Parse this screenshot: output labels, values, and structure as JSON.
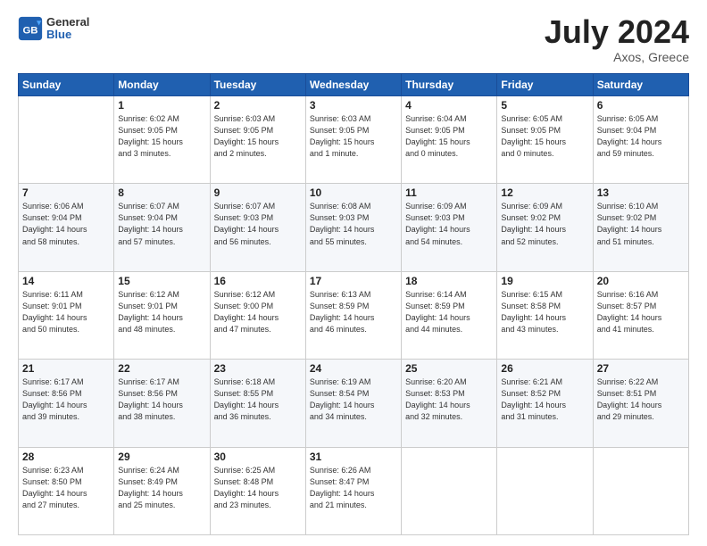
{
  "header": {
    "logo_line1": "General",
    "logo_line2": "Blue",
    "title": "July 2024",
    "location": "Axos, Greece"
  },
  "weekdays": [
    "Sunday",
    "Monday",
    "Tuesday",
    "Wednesday",
    "Thursday",
    "Friday",
    "Saturday"
  ],
  "weeks": [
    [
      {
        "day": "",
        "info": ""
      },
      {
        "day": "1",
        "info": "Sunrise: 6:02 AM\nSunset: 9:05 PM\nDaylight: 15 hours\nand 3 minutes."
      },
      {
        "day": "2",
        "info": "Sunrise: 6:03 AM\nSunset: 9:05 PM\nDaylight: 15 hours\nand 2 minutes."
      },
      {
        "day": "3",
        "info": "Sunrise: 6:03 AM\nSunset: 9:05 PM\nDaylight: 15 hours\nand 1 minute."
      },
      {
        "day": "4",
        "info": "Sunrise: 6:04 AM\nSunset: 9:05 PM\nDaylight: 15 hours\nand 0 minutes."
      },
      {
        "day": "5",
        "info": "Sunrise: 6:05 AM\nSunset: 9:05 PM\nDaylight: 15 hours\nand 0 minutes."
      },
      {
        "day": "6",
        "info": "Sunrise: 6:05 AM\nSunset: 9:04 PM\nDaylight: 14 hours\nand 59 minutes."
      }
    ],
    [
      {
        "day": "7",
        "info": "Sunrise: 6:06 AM\nSunset: 9:04 PM\nDaylight: 14 hours\nand 58 minutes."
      },
      {
        "day": "8",
        "info": "Sunrise: 6:07 AM\nSunset: 9:04 PM\nDaylight: 14 hours\nand 57 minutes."
      },
      {
        "day": "9",
        "info": "Sunrise: 6:07 AM\nSunset: 9:03 PM\nDaylight: 14 hours\nand 56 minutes."
      },
      {
        "day": "10",
        "info": "Sunrise: 6:08 AM\nSunset: 9:03 PM\nDaylight: 14 hours\nand 55 minutes."
      },
      {
        "day": "11",
        "info": "Sunrise: 6:09 AM\nSunset: 9:03 PM\nDaylight: 14 hours\nand 54 minutes."
      },
      {
        "day": "12",
        "info": "Sunrise: 6:09 AM\nSunset: 9:02 PM\nDaylight: 14 hours\nand 52 minutes."
      },
      {
        "day": "13",
        "info": "Sunrise: 6:10 AM\nSunset: 9:02 PM\nDaylight: 14 hours\nand 51 minutes."
      }
    ],
    [
      {
        "day": "14",
        "info": "Sunrise: 6:11 AM\nSunset: 9:01 PM\nDaylight: 14 hours\nand 50 minutes."
      },
      {
        "day": "15",
        "info": "Sunrise: 6:12 AM\nSunset: 9:01 PM\nDaylight: 14 hours\nand 48 minutes."
      },
      {
        "day": "16",
        "info": "Sunrise: 6:12 AM\nSunset: 9:00 PM\nDaylight: 14 hours\nand 47 minutes."
      },
      {
        "day": "17",
        "info": "Sunrise: 6:13 AM\nSunset: 8:59 PM\nDaylight: 14 hours\nand 46 minutes."
      },
      {
        "day": "18",
        "info": "Sunrise: 6:14 AM\nSunset: 8:59 PM\nDaylight: 14 hours\nand 44 minutes."
      },
      {
        "day": "19",
        "info": "Sunrise: 6:15 AM\nSunset: 8:58 PM\nDaylight: 14 hours\nand 43 minutes."
      },
      {
        "day": "20",
        "info": "Sunrise: 6:16 AM\nSunset: 8:57 PM\nDaylight: 14 hours\nand 41 minutes."
      }
    ],
    [
      {
        "day": "21",
        "info": "Sunrise: 6:17 AM\nSunset: 8:56 PM\nDaylight: 14 hours\nand 39 minutes."
      },
      {
        "day": "22",
        "info": "Sunrise: 6:17 AM\nSunset: 8:56 PM\nDaylight: 14 hours\nand 38 minutes."
      },
      {
        "day": "23",
        "info": "Sunrise: 6:18 AM\nSunset: 8:55 PM\nDaylight: 14 hours\nand 36 minutes."
      },
      {
        "day": "24",
        "info": "Sunrise: 6:19 AM\nSunset: 8:54 PM\nDaylight: 14 hours\nand 34 minutes."
      },
      {
        "day": "25",
        "info": "Sunrise: 6:20 AM\nSunset: 8:53 PM\nDaylight: 14 hours\nand 32 minutes."
      },
      {
        "day": "26",
        "info": "Sunrise: 6:21 AM\nSunset: 8:52 PM\nDaylight: 14 hours\nand 31 minutes."
      },
      {
        "day": "27",
        "info": "Sunrise: 6:22 AM\nSunset: 8:51 PM\nDaylight: 14 hours\nand 29 minutes."
      }
    ],
    [
      {
        "day": "28",
        "info": "Sunrise: 6:23 AM\nSunset: 8:50 PM\nDaylight: 14 hours\nand 27 minutes."
      },
      {
        "day": "29",
        "info": "Sunrise: 6:24 AM\nSunset: 8:49 PM\nDaylight: 14 hours\nand 25 minutes."
      },
      {
        "day": "30",
        "info": "Sunrise: 6:25 AM\nSunset: 8:48 PM\nDaylight: 14 hours\nand 23 minutes."
      },
      {
        "day": "31",
        "info": "Sunrise: 6:26 AM\nSunset: 8:47 PM\nDaylight: 14 hours\nand 21 minutes."
      },
      {
        "day": "",
        "info": ""
      },
      {
        "day": "",
        "info": ""
      },
      {
        "day": "",
        "info": ""
      }
    ]
  ]
}
